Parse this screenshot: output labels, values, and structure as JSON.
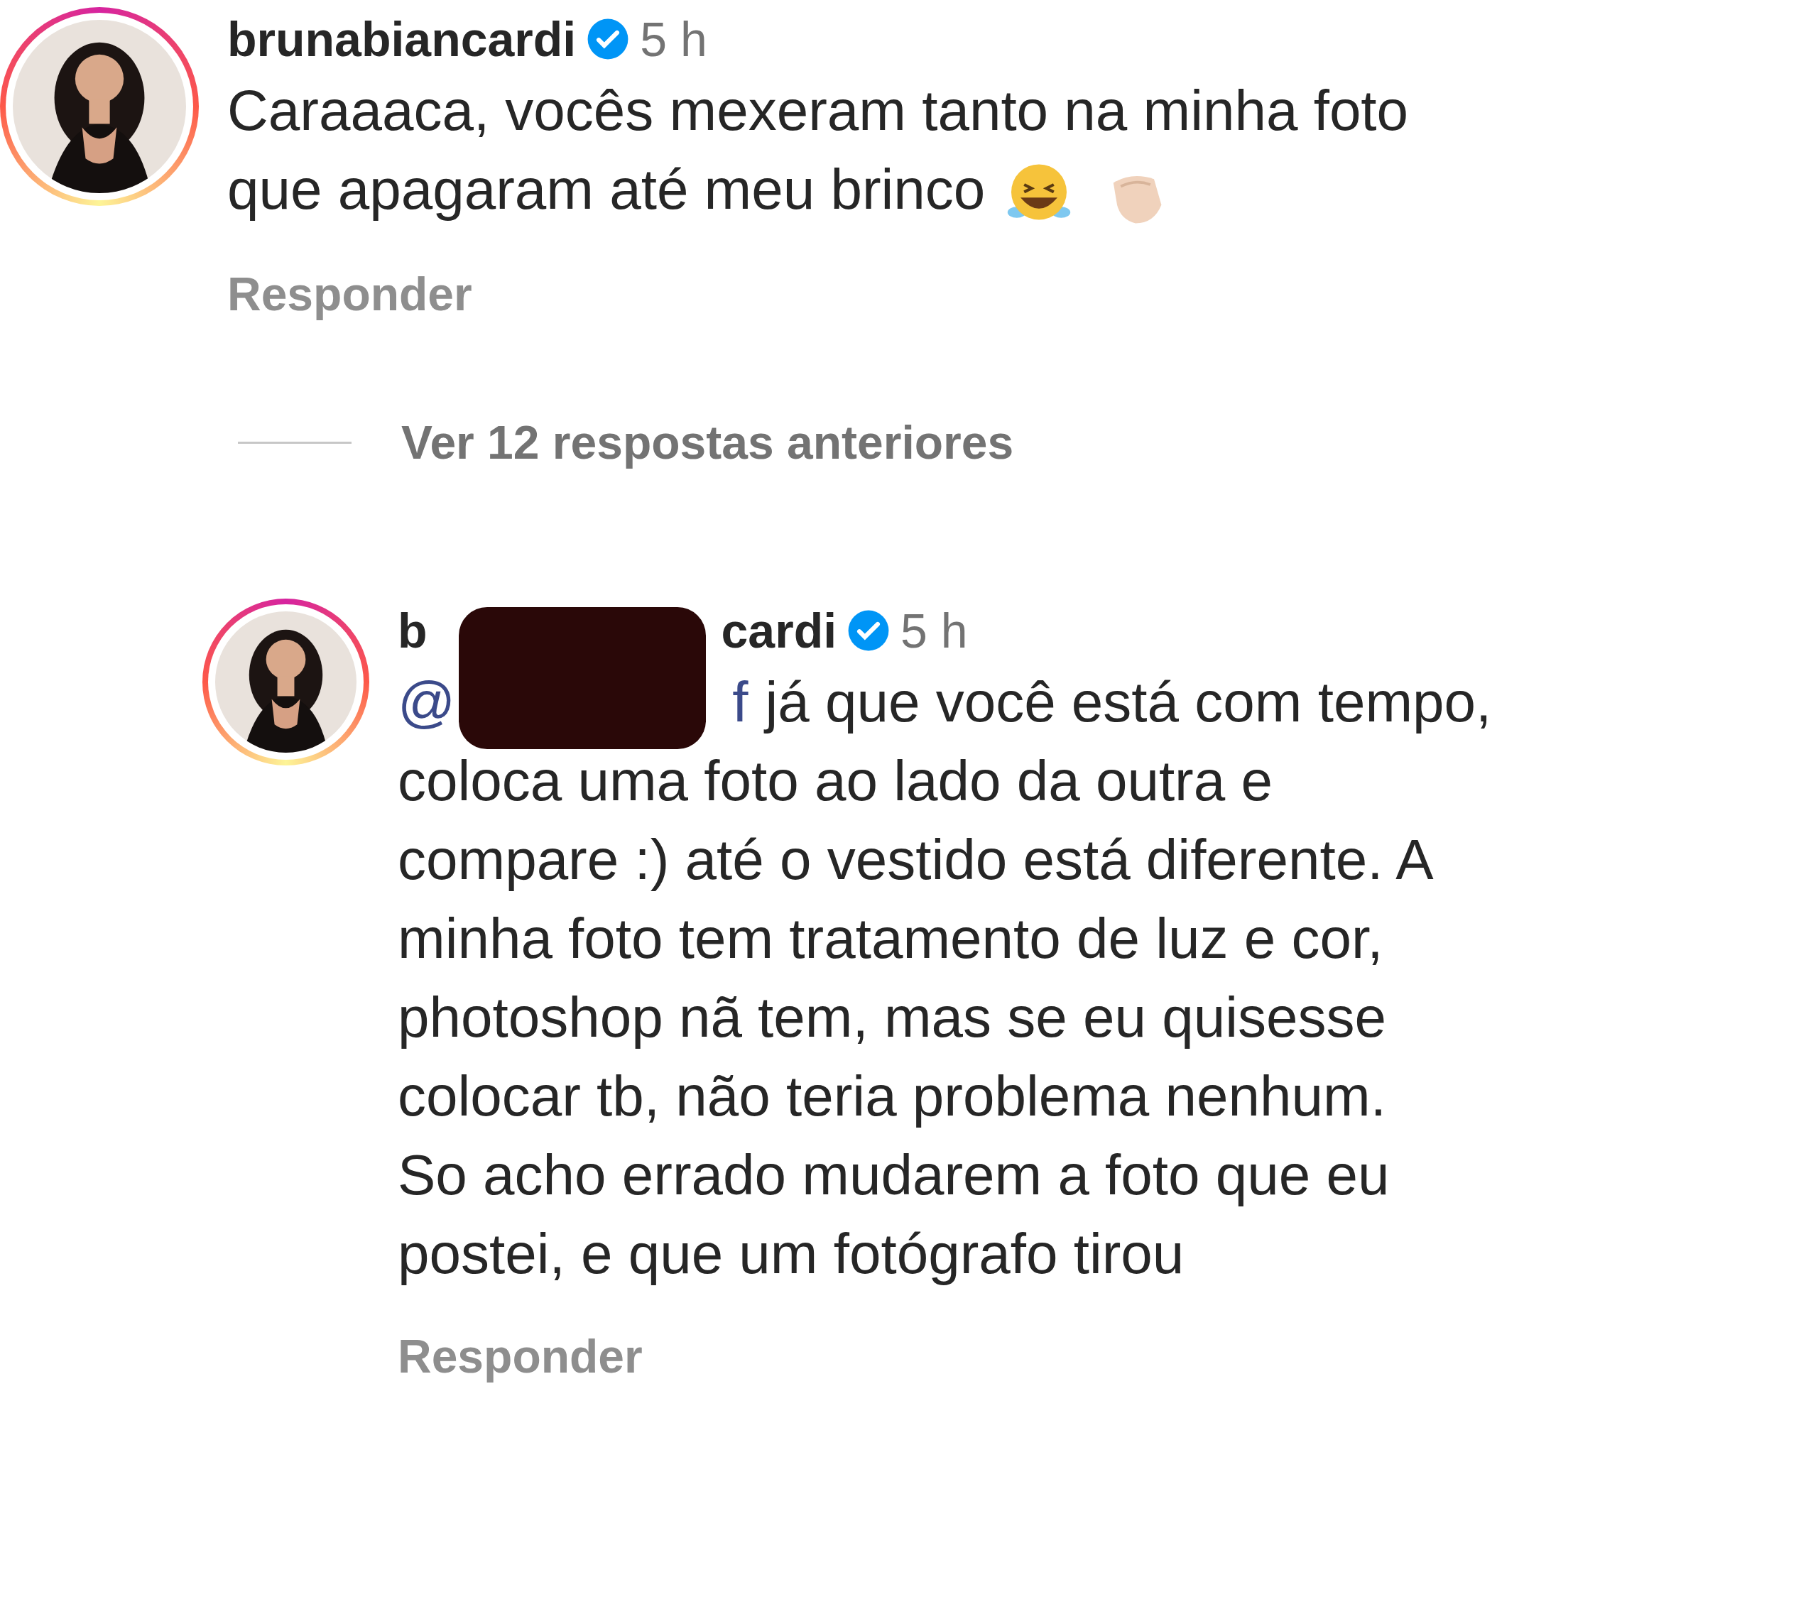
{
  "comments": [
    {
      "username_parts": [
        "brunabiancardi"
      ],
      "verified": true,
      "time": "5 h",
      "lines": [
        "Caraaaca, vocês mexeram tanto na minha foto",
        "que apagaram até meu brinco"
      ],
      "emojis": [
        {
          "kind": "laughing"
        },
        {
          "kind": "clap"
        }
      ],
      "reply": "Responder"
    },
    {
      "username_parts": [
        "b",
        "cardi"
      ],
      "verified": true,
      "time": "5 h",
      "mention_parts": [
        "@",
        "f"
      ],
      "lines": [
        "já que você está com tempo,",
        "coloca uma foto ao lado da outra e",
        "compare :) até o vestido está diferente. A",
        "minha foto tem tratamento de luz e cor,",
        "photoshop nã tem, mas se eu quisesse",
        "colocar tb, não teria problema nenhum.",
        "So acho errado mudarem a foto que eu",
        "postei, e que um fotógrafo tirou"
      ],
      "reply": "Responder",
      "redacted": true
    }
  ],
  "view_replies": "Ver 12 respostas anteriores"
}
